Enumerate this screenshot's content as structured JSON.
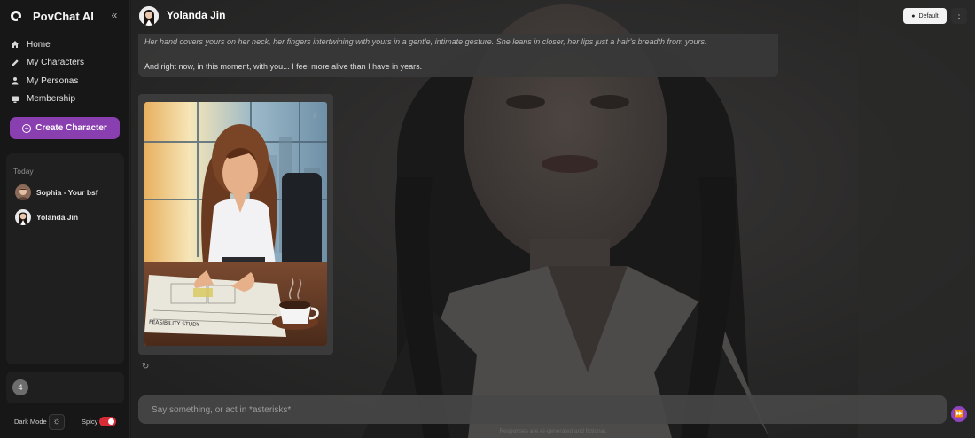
{
  "app": {
    "brand": "PovChat AI",
    "accent": "#8a3fb0"
  },
  "sidebar": {
    "collapse_icon": "double-chevron-left-icon",
    "nav": [
      {
        "label": "Home",
        "icon": "home-icon"
      },
      {
        "label": "My Characters",
        "icon": "pencil-icon"
      },
      {
        "label": "My Personas",
        "icon": "person-icon"
      },
      {
        "label": "Membership",
        "icon": "card-icon"
      }
    ],
    "create_button": "Create Character",
    "history": {
      "heading": "Today",
      "items": [
        {
          "name": "Sophia - Your bsf"
        },
        {
          "name": "Yolanda Jin"
        }
      ]
    },
    "user": {
      "avatar_text": "4"
    },
    "dark_mode_label": "Dark Mode",
    "spicy_label": "Spicy",
    "spicy_on": true
  },
  "header": {
    "character_name": "Yolanda Jin",
    "mode_button": "Default"
  },
  "messages": {
    "italic": "Her hand covers yours on her neck, her fingers intertwining with yours in a gentle, intimate gesture. She leans in closer, her lips just a hair's breadth from yours.",
    "plain": "And right now, in this moment, with you... I feel more alive than I have in years."
  },
  "composer": {
    "placeholder": "Say something, or act in *asterisks*",
    "disclaimer": "Responses are AI-generated and fictional."
  }
}
